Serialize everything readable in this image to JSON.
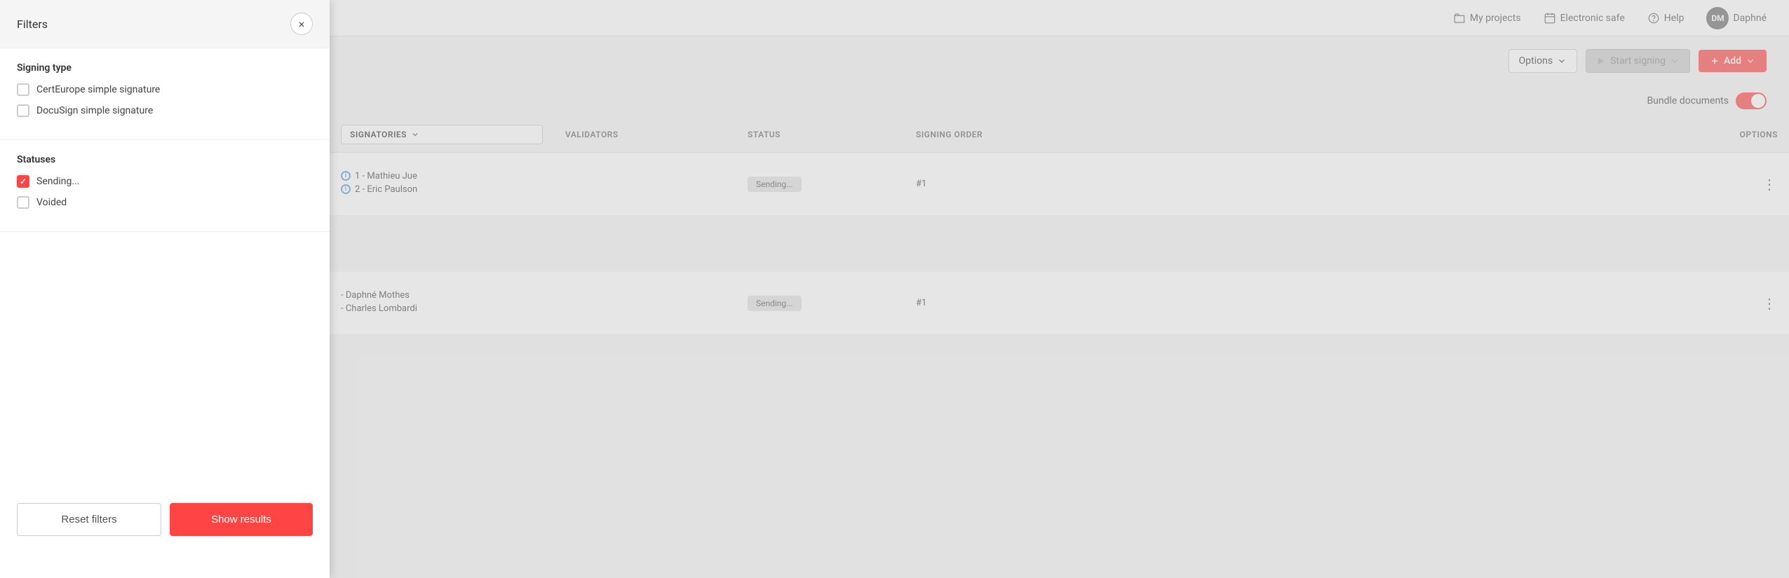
{
  "topbar": {
    "my_projects_label": "My projects",
    "electronic_safe_label": "Electronic safe",
    "help_label": "Help",
    "user_initials": "DM",
    "user_name": "Daphné"
  },
  "toolbar": {
    "options_label": "Options",
    "start_signing_label": "Start signing",
    "add_label": "Add"
  },
  "bundle": {
    "label": "Bundle documents"
  },
  "table": {
    "col_signatories": "SIGNATORIES",
    "col_validators": "VALIDATORS",
    "col_status": "STATUS",
    "col_signing_order": "SIGNING ORDER",
    "col_options": "OPTIONS",
    "rows": [
      {
        "signatories": [
          "1 - Mathieu Jue",
          "2 - Eric Paulson"
        ],
        "status": "Sending...",
        "signing_order": "#1"
      },
      {
        "signatories": [
          "- Daphné Mothes",
          "- Charles Lombardi"
        ],
        "status": "Sending...",
        "signing_order": "#1"
      }
    ]
  },
  "filter_panel": {
    "title": "Filters",
    "close_label": "×",
    "signing_type_section": {
      "title": "Signing type",
      "options": [
        {
          "label": "CertEurope simple signature",
          "checked": false
        },
        {
          "label": "DocuSign simple signature",
          "checked": false
        }
      ]
    },
    "statuses_section": {
      "title": "Statuses",
      "options": [
        {
          "label": "Sending...",
          "checked": true
        },
        {
          "label": "Voided",
          "checked": false
        }
      ]
    },
    "reset_label": "Reset filters",
    "show_results_label": "Show results"
  }
}
